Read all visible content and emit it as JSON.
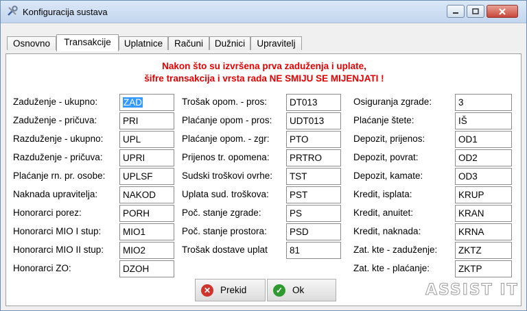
{
  "window": {
    "title": "Konfiguracija sustava"
  },
  "tabs": [
    "Osnovno",
    "Transakcije",
    "Uplatnice",
    "Računi",
    "Dužnici",
    "Upravitelj"
  ],
  "active_tab": "Transakcije",
  "warning": {
    "line1": "Nakon što su izvršena prva zaduženja i uplate,",
    "line2": "šifre transakcija i vrsta rada NE SMIJU SE MIJENJATI !"
  },
  "col1": [
    {
      "label": "Zaduženje - ukupno:",
      "value": "ZAD"
    },
    {
      "label": "Zaduženje - pričuva:",
      "value": "PRI"
    },
    {
      "label": "Razduženje - ukupno:",
      "value": "UPL"
    },
    {
      "label": "Razduženje - pričuva:",
      "value": "UPRI"
    },
    {
      "label": "Plaćanje rn. pr. osobe:",
      "value": "UPLSF"
    },
    {
      "label": "Naknada upravitelja:",
      "value": "NAKOD"
    },
    {
      "label": "Honorarci porez:",
      "value": "PORH"
    },
    {
      "label": "Honorarci MIO I stup:",
      "value": "MIO1"
    },
    {
      "label": "Honorarci MIO II stup:",
      "value": "MIO2"
    },
    {
      "label": "Honorarci ZO:",
      "value": "DZOH"
    }
  ],
  "col2": [
    {
      "label": "Trošak opom. - pros:",
      "value": "DT013"
    },
    {
      "label": "Plaćanje opom - pros:",
      "value": "UDT013"
    },
    {
      "label": "Plaćanje opom. - zgr:",
      "value": "PTO"
    },
    {
      "label": "Prijenos tr. opomena:",
      "value": "PRTRO"
    },
    {
      "label": "Sudski troškovi ovrhe:",
      "value": "TST"
    },
    {
      "label": "Uplata sud. troškova:",
      "value": "PST"
    },
    {
      "label": "Poč. stanje zgrade:",
      "value": "PS"
    },
    {
      "label": "Poč. stanje prostora:",
      "value": "PSD"
    },
    {
      "label": "Trošak dostave uplat",
      "value": "81"
    }
  ],
  "col3": [
    {
      "label": "Osiguranja zgrade:",
      "value": "3"
    },
    {
      "label": "Plaćanje štete:",
      "value": "IŠ"
    },
    {
      "label": "Depozit, prijenos:",
      "value": "OD1"
    },
    {
      "label": "Depozit, povrat:",
      "value": "OD2"
    },
    {
      "label": "Depozit, kamate:",
      "value": "OD3"
    },
    {
      "label": "Kredit, isplata:",
      "value": "KRUP"
    },
    {
      "label": "Kredit, anuitet:",
      "value": "KRAN"
    },
    {
      "label": "Kredit, naknada:",
      "value": "KRNA"
    },
    {
      "label": "Zat. kte - zaduženje:",
      "value": "ZKTZ"
    },
    {
      "label": "Zat. kte - plaćanje:",
      "value": "ZKTP"
    }
  ],
  "buttons": {
    "cancel": "Prekid",
    "ok": "Ok"
  },
  "logo_text": "ASSIST IT",
  "colors": {
    "warning": "#e40000",
    "selection": "#3399ff",
    "close_button": "#c9463a"
  }
}
